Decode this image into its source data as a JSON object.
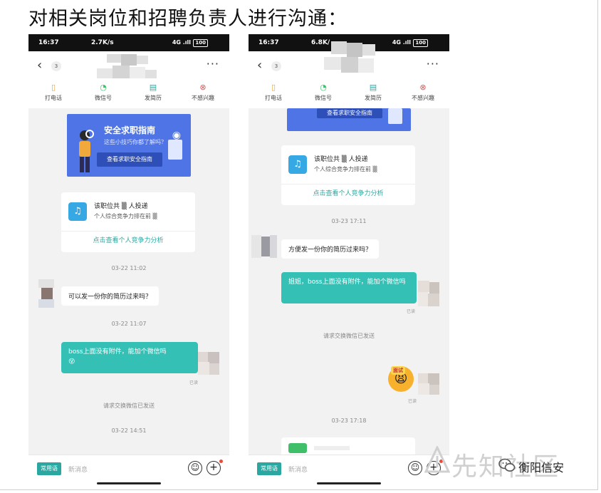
{
  "heading": "对相关岗位和招聘负责人进行沟通：",
  "left": {
    "status": {
      "time": "16:37",
      "speed": "2.7K/s",
      "signal": "4G .ıll",
      "battery": "100"
    },
    "badge": "3",
    "more": "···",
    "actions": [
      {
        "label": "打电话",
        "icon": "phone-icon",
        "glyph": "▯"
      },
      {
        "label": "微信号",
        "icon": "wechat-icon",
        "glyph": "◔"
      },
      {
        "label": "发简历",
        "icon": "resume-icon",
        "glyph": "▤"
      },
      {
        "label": "不感兴趣",
        "icon": "not-interested-icon",
        "glyph": "⊗"
      }
    ],
    "banner": {
      "title": "安全求职指南",
      "subtitle": "这些小技巧你都了解吗？",
      "button": "查看求职安全指南"
    },
    "card": {
      "line1": "该职位共 ▒ 人投递",
      "line2": "个人综合竞争力排在前 ▒",
      "link": "点击查看个人竞争力分析"
    },
    "ts1": "03-22 11:02",
    "msg_in": "可以发一份你的简历过来吗？",
    "ts2": "03-22 11:07",
    "msg_out": "boss上面没有附件，能加个微信吗",
    "msg_out_emoji": "😵",
    "read": "已读",
    "sys": "请求交换微信已发送",
    "ts3": "03-22 14:51",
    "input": {
      "chip": "常用语",
      "placeholder": "新消息",
      "emoji": "☺",
      "plus": "+"
    }
  },
  "right": {
    "status": {
      "time": "16:37",
      "speed": "6.8K/",
      "signal": "4G .ıll",
      "battery": "100"
    },
    "badge": "3",
    "more": "···",
    "actions": [
      {
        "label": "打电话",
        "icon": "phone-icon",
        "glyph": "▯"
      },
      {
        "label": "微信号",
        "icon": "wechat-icon",
        "glyph": "◔"
      },
      {
        "label": "发简历",
        "icon": "resume-icon",
        "glyph": "▤"
      },
      {
        "label": "不感兴趣",
        "icon": "not-interested-icon",
        "glyph": "⊗"
      }
    ],
    "banner_button": "查看求职安全指南",
    "card": {
      "line1": "该职位共 ▒ 人投递",
      "line2": "个人综合竞争力排在前 ▒",
      "link": "点击查看个人竞争力分析"
    },
    "ts1": "03-23 17:11",
    "msg_in": "方便发一份你的简历过来吗？",
    "msg_out": "姐姐，boss上面没有附件，能加个微信吗",
    "read": "已读",
    "sys": "请求交换微信已发送",
    "sticker_tag": "面试",
    "sticker_face": "😫",
    "read2": "已读",
    "ts2": "03-23 17:18",
    "input": {
      "chip": "常用语",
      "placeholder": "新消息",
      "emoji": "☺",
      "plus": "+"
    }
  },
  "watermark": {
    "site": "先知社区",
    "account": "衡阳信安"
  },
  "colors": {
    "accent": "#34c0b4",
    "banner": "#4f74e6",
    "bell": "#36a8e4"
  }
}
